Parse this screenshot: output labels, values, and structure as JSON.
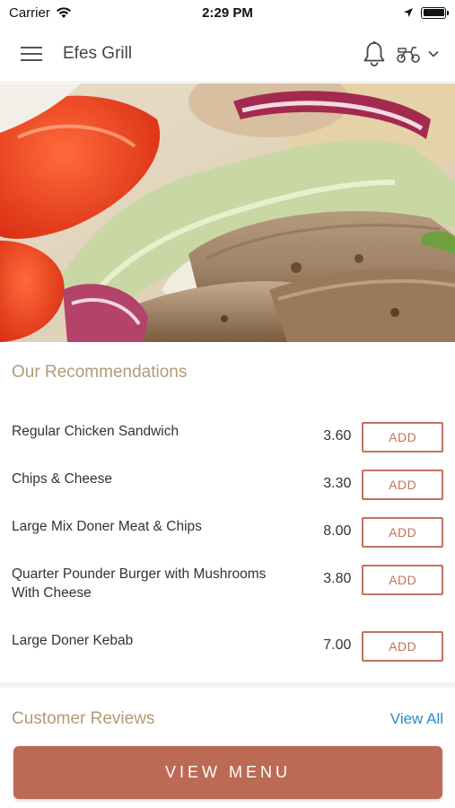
{
  "status_bar": {
    "carrier": "Carrier",
    "time": "2:29 PM"
  },
  "header": {
    "title": "Efes Grill"
  },
  "recommendations": {
    "title": "Our Recommendations",
    "items": [
      {
        "name": "Regular Chicken Sandwich",
        "price": "3.60",
        "button": "ADD"
      },
      {
        "name": "Chips & Cheese",
        "price": "3.30",
        "button": "ADD"
      },
      {
        "name": "Large Mix Doner Meat & Chips",
        "price": "8.00",
        "button": "ADD"
      },
      {
        "name": "Quarter Pounder Burger with Mushrooms With Cheese",
        "price": "3.80",
        "button": "ADD"
      },
      {
        "name": "Large Doner Kebab",
        "price": "7.00",
        "button": "ADD"
      }
    ]
  },
  "reviews": {
    "title": "Customer Reviews",
    "view_all": "View All"
  },
  "footer": {
    "view_menu": "VIEW MENU"
  },
  "colors": {
    "accent": "#bc6a55",
    "section_title": "#b09b77",
    "link": "#2a8cc0"
  },
  "icons": {
    "menu": "hamburger-icon",
    "bell": "bell-icon",
    "delivery": "scooter-icon",
    "dropdown": "chevron-down-icon"
  }
}
